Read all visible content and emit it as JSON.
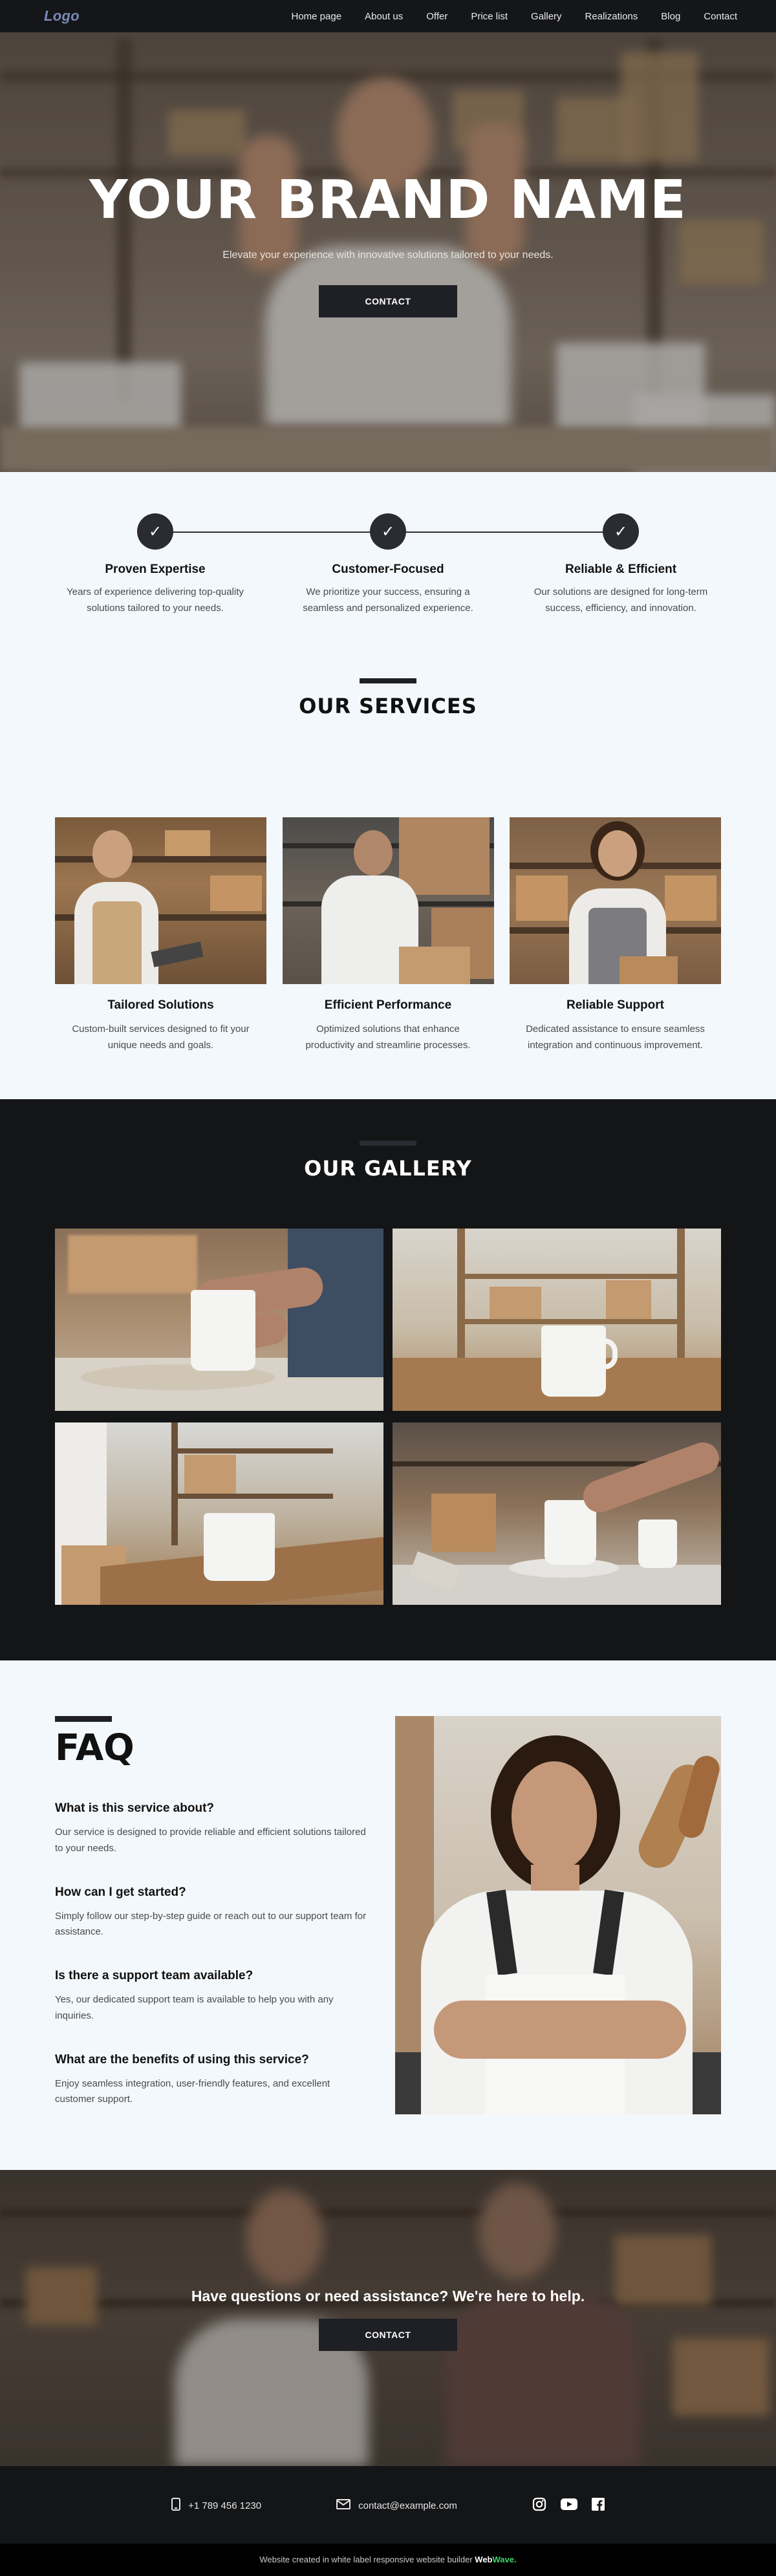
{
  "nav": {
    "logo": "Logo",
    "items": [
      "Home page",
      "About us",
      "Offer",
      "Price list",
      "Gallery",
      "Realizations",
      "Blog",
      "Contact"
    ]
  },
  "hero": {
    "title": "YOUR BRAND NAME",
    "subtitle": "Elevate your experience with innovative solutions tailored to your needs.",
    "button": "CONTACT"
  },
  "features": [
    {
      "title": "Proven Expertise",
      "text": "Years of experience delivering top-quality solutions tailored to your needs."
    },
    {
      "title": "Customer-Focused",
      "text": "We prioritize your success, ensuring a seamless and personalized experience."
    },
    {
      "title": "Reliable & Efficient",
      "text": "Our solutions are designed for long-term success, efficiency, and innovation."
    }
  ],
  "services": {
    "title": "OUR SERVICES",
    "items": [
      {
        "title": "Tailored Solutions",
        "text": "Custom-built services designed to fit your unique needs and goals."
      },
      {
        "title": "Efficient Performance",
        "text": "Optimized solutions that enhance productivity and streamline processes."
      },
      {
        "title": "Reliable Support",
        "text": "Dedicated assistance to ensure seamless integration and continuous improvement."
      }
    ]
  },
  "gallery": {
    "title": "OUR GALLERY"
  },
  "faq": {
    "title": "FAQ",
    "items": [
      {
        "q": "What is this service about?",
        "a": "Our service is designed to provide reliable and efficient solutions tailored to your needs."
      },
      {
        "q": "How can I get started?",
        "a": "Simply follow our step-by-step guide or reach out to our support team for assistance."
      },
      {
        "q": "Is there a support team available?",
        "a": "Yes, our dedicated support team is available to help you with any inquiries."
      },
      {
        "q": "What are the benefits of using this service?",
        "a": "Enjoy seamless integration, user-friendly features, and excellent customer support."
      }
    ]
  },
  "cta": {
    "title": "Have questions or need assistance? We're here to help.",
    "button": "CONTACT"
  },
  "footer": {
    "phone": "+1 789 456 1230",
    "email": "contact@example.com",
    "credit_prefix": "Website created in white label responsive website builder",
    "brand_a": "Web",
    "brand_b": "Wave."
  },
  "colors": {
    "dark": "#1f2026",
    "section_bg": "#f3f8fc",
    "accent_green": "#3fd76a"
  }
}
